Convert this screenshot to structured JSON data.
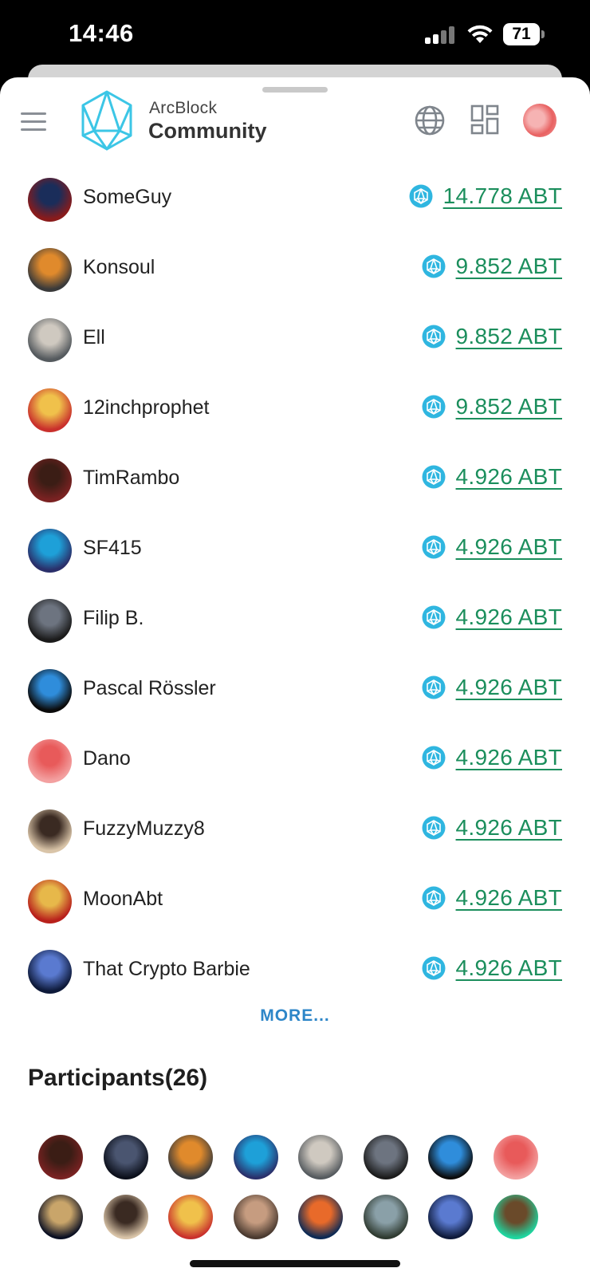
{
  "status_bar": {
    "time": "14:46",
    "battery": "71"
  },
  "header": {
    "brand_top": "ArcBlock",
    "brand_bottom": "Community",
    "icons": [
      "menu-icon",
      "arcblock-logo-icon",
      "globe-icon",
      "grid-icon",
      "user-avatar"
    ]
  },
  "tippers": [
    {
      "name": "SomeGuy",
      "amount": "14.778 ABT",
      "avatar_colors": [
        "#8a1b1b",
        "#1a2d5a"
      ]
    },
    {
      "name": "Konsoul",
      "amount": "9.852 ABT",
      "avatar_colors": [
        "#3a3a3a",
        "#e08a2c"
      ]
    },
    {
      "name": "Ell",
      "amount": "9.852 ABT",
      "avatar_colors": [
        "#555a5e",
        "#cfc9c0"
      ]
    },
    {
      "name": "12inchprophet",
      "amount": "9.852 ABT",
      "avatar_colors": [
        "#c9302c",
        "#f0c14b"
      ]
    },
    {
      "name": "TimRambo",
      "amount": "4.926 ABT",
      "avatar_colors": [
        "#7a2222",
        "#3b1d15"
      ]
    },
    {
      "name": "SF415",
      "amount": "4.926 ABT",
      "avatar_colors": [
        "#2a2f6a",
        "#1ea0d8"
      ]
    },
    {
      "name": "Filip B.",
      "amount": "4.926 ABT",
      "avatar_colors": [
        "#1b1b1b",
        "#6d7480"
      ]
    },
    {
      "name": "Pascal Rössler",
      "amount": "4.926 ABT",
      "avatar_colors": [
        "#0b0b0b",
        "#2f8ddb"
      ]
    },
    {
      "name": "Dano",
      "amount": "4.926 ABT",
      "avatar_colors": [
        "#f3a0a0",
        "#e85a5a"
      ]
    },
    {
      "name": "FuzzyMuzzy8",
      "amount": "4.926 ABT",
      "avatar_colors": [
        "#d9c4a8",
        "#3a2a22"
      ]
    },
    {
      "name": "MoonAbt",
      "amount": "4.926 ABT",
      "avatar_colors": [
        "#b8201b",
        "#e7b84a"
      ]
    },
    {
      "name": "That Crypto Barbie",
      "amount": "4.926 ABT",
      "avatar_colors": [
        "#0e1a3a",
        "#5a7ad0"
      ]
    }
  ],
  "more_label": "MORE...",
  "participants": {
    "title": "Participants(26)",
    "avatars": [
      {
        "colors": [
          "#7a2222",
          "#3b1d15"
        ]
      },
      {
        "colors": [
          "#0b0f1a",
          "#4a5570"
        ]
      },
      {
        "colors": [
          "#3a3a3a",
          "#e08a2c"
        ]
      },
      {
        "colors": [
          "#2a2f6a",
          "#1ea0d8"
        ]
      },
      {
        "colors": [
          "#555a5e",
          "#cfc9c0"
        ]
      },
      {
        "colors": [
          "#1b1b1b",
          "#6d7480"
        ]
      },
      {
        "colors": [
          "#0b0b0b",
          "#2f8ddb"
        ]
      },
      {
        "colors": [
          "#f3a0a0",
          "#e85a5a"
        ]
      },
      {
        "colors": [
          "#0a0f22",
          "#c9a56a"
        ]
      },
      {
        "colors": [
          "#d9c4a8",
          "#3a2a22"
        ]
      },
      {
        "colors": [
          "#c9302c",
          "#f0c14b"
        ]
      },
      {
        "colors": [
          "#4a3a30",
          "#c69c80"
        ]
      },
      {
        "colors": [
          "#0c2a55",
          "#e86a2a"
        ]
      },
      {
        "colors": [
          "#2f3a30",
          "#8aa0a8"
        ]
      },
      {
        "colors": [
          "#0e1a3a",
          "#5a7ad0"
        ]
      },
      {
        "colors": [
          "#1ed6a0",
          "#6a4a2a"
        ]
      }
    ]
  },
  "colors": {
    "amount_link": "#1b8e5c",
    "more_link": "#2d86c8",
    "abt_icon": "#2fb6e0"
  }
}
